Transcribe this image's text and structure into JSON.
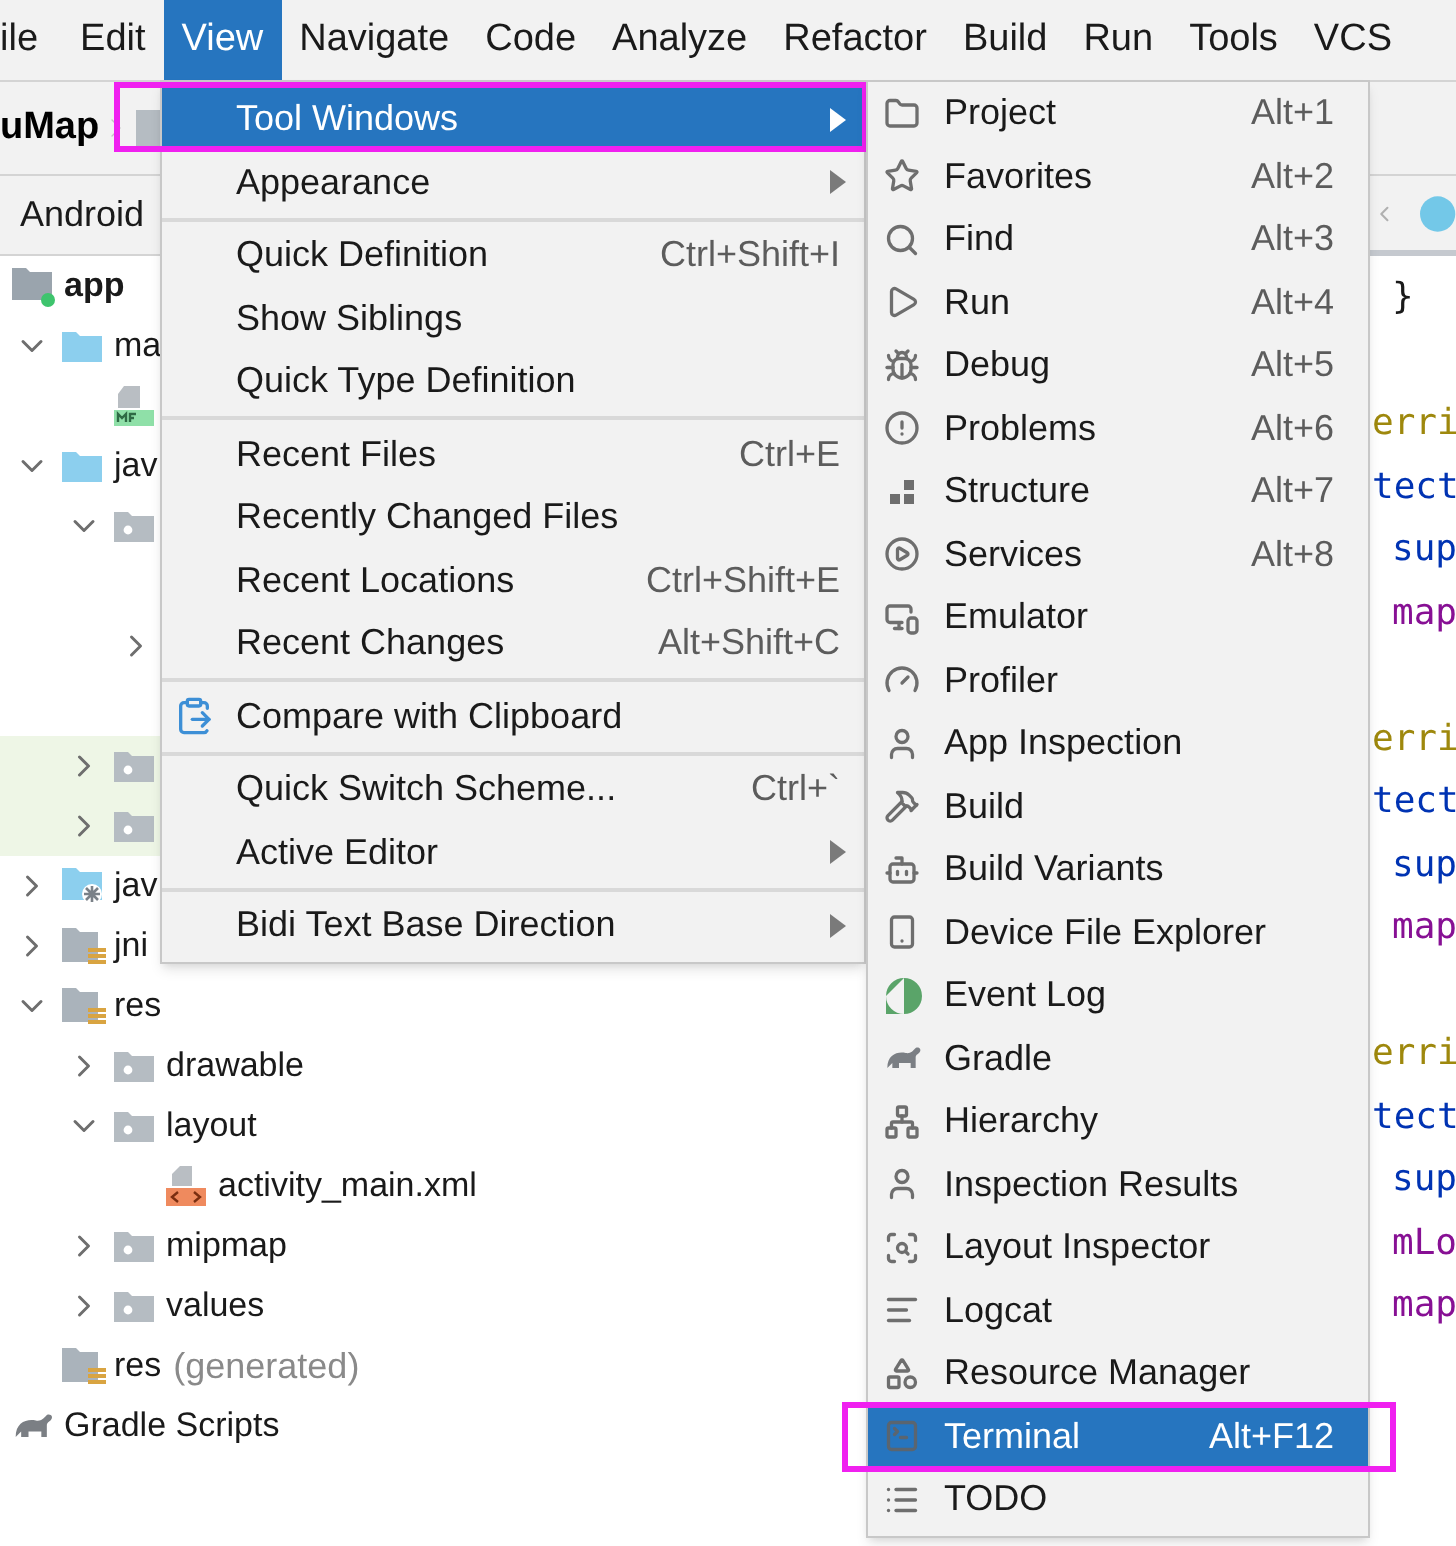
{
  "menu_bar": [
    {
      "label": "ile",
      "selected": false
    },
    {
      "label": "Edit",
      "selected": false
    },
    {
      "label": "View",
      "selected": true
    },
    {
      "label": "Navigate",
      "selected": false
    },
    {
      "label": "Code",
      "selected": false
    },
    {
      "label": "Analyze",
      "selected": false
    },
    {
      "label": "Refactor",
      "selected": false
    },
    {
      "label": "Build",
      "selected": false
    },
    {
      "label": "Run",
      "selected": false
    },
    {
      "label": "Tools",
      "selected": false
    },
    {
      "label": "VCS",
      "selected": false
    }
  ],
  "breadcrumb": {
    "project": "uMap"
  },
  "project_panel": {
    "view_selector": "Android",
    "tree": [
      {
        "kind": "module",
        "label": "app",
        "children": [
          {
            "kind": "folder",
            "label": "ma",
            "expanded": true,
            "children": [
              {
                "kind": "manifest"
              }
            ]
          },
          {
            "kind": "folder",
            "label": "jav",
            "expanded": true,
            "children": [
              {
                "kind": "package",
                "expanded": true,
                "children": [
                  {
                    "kind": "covered"
                  },
                  {
                    "kind": "covered",
                    "expanded": false
                  },
                  {
                    "kind": "covered"
                  }
                ]
              },
              {
                "kind": "package",
                "expanded": false,
                "highlighted": true
              },
              {
                "kind": "package",
                "expanded": false,
                "highlighted": true
              }
            ]
          },
          {
            "kind": "java-gen",
            "label": "jav",
            "expanded": false
          },
          {
            "kind": "lib",
            "label": "jni",
            "expanded": false
          },
          {
            "kind": "lib",
            "label": "res",
            "expanded": true,
            "children": [
              {
                "kind": "package",
                "label": "drawable",
                "expanded": false
              },
              {
                "kind": "package",
                "label": "layout",
                "expanded": true,
                "children": [
                  {
                    "kind": "xml",
                    "label": "activity_main.xml"
                  }
                ]
              },
              {
                "kind": "package",
                "label": "mipmap",
                "expanded": false
              },
              {
                "kind": "package",
                "label": "values",
                "expanded": false
              }
            ]
          },
          {
            "kind": "lib",
            "label": "res",
            "note": "(generated)"
          }
        ]
      },
      {
        "kind": "gradle",
        "label": "Gradle Scripts"
      }
    ]
  },
  "editor": {
    "code_lines": [
      {
        "kind": "brace",
        "text": "}",
        "indent": true
      },
      {
        "kind": "blank"
      },
      {
        "kind": "annotation",
        "text": "erri"
      },
      {
        "kind": "keyword",
        "text": "tect"
      },
      {
        "kind": "keyword",
        "text": "sup",
        "indent": true
      },
      {
        "kind": "field",
        "text": "map",
        "indent": true
      },
      {
        "kind": "blank"
      },
      {
        "kind": "annotation",
        "text": "erri"
      },
      {
        "kind": "keyword",
        "text": "tect"
      },
      {
        "kind": "keyword",
        "text": "sup",
        "indent": true
      },
      {
        "kind": "field",
        "text": "map",
        "indent": true
      },
      {
        "kind": "blank"
      },
      {
        "kind": "annotation",
        "text": "erri"
      },
      {
        "kind": "keyword",
        "text": "tect"
      },
      {
        "kind": "keyword",
        "text": "sup",
        "indent": true
      },
      {
        "kind": "field",
        "text": "mLo",
        "indent": true
      },
      {
        "kind": "field",
        "text": "map",
        "indent": true
      }
    ]
  },
  "view_menu": {
    "items": [
      {
        "kind": "item",
        "label": "Tool Windows",
        "submenu": true,
        "selected": true,
        "outlined": true
      },
      {
        "kind": "item",
        "label": "Appearance",
        "submenu": true,
        "selected": false
      },
      {
        "kind": "separator"
      },
      {
        "kind": "item",
        "label": "Quick Definition",
        "shortcut": "Ctrl+Shift+I",
        "selected": false
      },
      {
        "kind": "item",
        "label": "Show Siblings",
        "selected": false
      },
      {
        "kind": "item",
        "label": "Quick Type Definition",
        "selected": false
      },
      {
        "kind": "separator"
      },
      {
        "kind": "item",
        "label": "Recent Files",
        "shortcut": "Ctrl+E",
        "selected": false
      },
      {
        "kind": "item",
        "label": "Recently Changed Files",
        "selected": false
      },
      {
        "kind": "item",
        "label": "Recent Locations",
        "shortcut": "Ctrl+Shift+E",
        "selected": false
      },
      {
        "kind": "item",
        "label": "Recent Changes",
        "shortcut": "Alt+Shift+C",
        "selected": false
      },
      {
        "kind": "separator"
      },
      {
        "kind": "item",
        "label": "Compare with Clipboard",
        "icon": true,
        "selected": false
      },
      {
        "kind": "separator"
      },
      {
        "kind": "item",
        "label": "Quick Switch Scheme...",
        "shortcut": "Ctrl+`",
        "selected": false
      },
      {
        "kind": "item",
        "label": "Active Editor",
        "submenu": true,
        "selected": false
      },
      {
        "kind": "separator"
      },
      {
        "kind": "item",
        "label": "Bidi Text Base Direction",
        "submenu": true,
        "selected": false
      }
    ]
  },
  "tool_windows_menu": {
    "items": [
      {
        "label": "Project",
        "shortcut": "Alt+1",
        "selected": false
      },
      {
        "label": "Favorites",
        "shortcut": "Alt+2",
        "selected": false
      },
      {
        "label": "Find",
        "shortcut": "Alt+3",
        "selected": false
      },
      {
        "label": "Run",
        "shortcut": "Alt+4",
        "selected": false
      },
      {
        "label": "Debug",
        "shortcut": "Alt+5",
        "selected": false
      },
      {
        "label": "Problems",
        "shortcut": "Alt+6",
        "selected": false
      },
      {
        "label": "Structure",
        "shortcut": "Alt+7",
        "selected": false
      },
      {
        "label": "Services",
        "shortcut": "Alt+8",
        "selected": false
      },
      {
        "label": "Emulator",
        "selected": false
      },
      {
        "label": "Profiler",
        "selected": false
      },
      {
        "label": "App Inspection",
        "selected": false
      },
      {
        "label": "Build",
        "selected": false
      },
      {
        "label": "Build Variants",
        "selected": false
      },
      {
        "label": "Device File Explorer",
        "selected": false
      },
      {
        "label": "Event Log",
        "selected": false
      },
      {
        "label": "Gradle",
        "selected": false
      },
      {
        "label": "Hierarchy",
        "selected": false
      },
      {
        "label": "Inspection Results",
        "selected": false
      },
      {
        "label": "Layout Inspector",
        "selected": false
      },
      {
        "label": "Logcat",
        "selected": false
      },
      {
        "label": "Resource Manager",
        "selected": false
      },
      {
        "label": "Terminal",
        "shortcut": "Alt+F12",
        "selected": true,
        "outlined": true
      },
      {
        "label": "TODO",
        "selected": false
      }
    ]
  }
}
